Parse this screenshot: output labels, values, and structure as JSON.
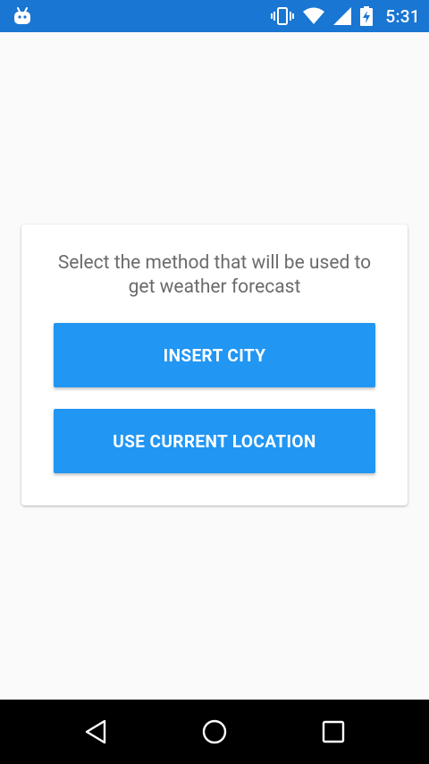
{
  "status_bar": {
    "time": "5:31",
    "icons": [
      "android-icon",
      "vibrate-icon",
      "wifi-icon",
      "cell-signal-icon",
      "battery-charging-icon"
    ],
    "background": "#1976d2"
  },
  "card": {
    "message": "Select the method that will be used to get weather forecast",
    "buttons": {
      "insert_city": "INSERT CITY",
      "use_location": "USE CURRENT LOCATION"
    },
    "button_color": "#2196f3"
  },
  "nav_bar": {
    "icons": [
      "back-icon",
      "home-icon",
      "recents-icon"
    ]
  }
}
